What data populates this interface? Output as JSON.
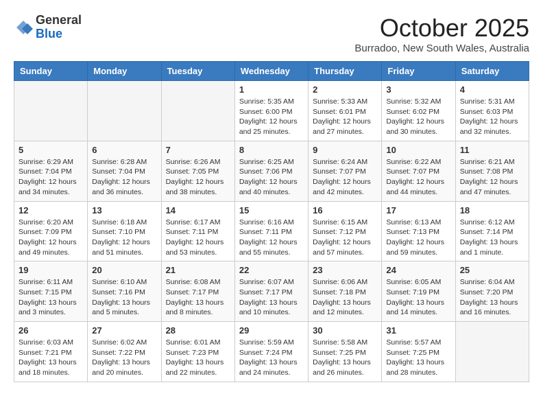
{
  "logo": {
    "general": "General",
    "blue": "Blue"
  },
  "title": {
    "month": "October 2025",
    "location": "Burradoo, New South Wales, Australia"
  },
  "weekdays": [
    "Sunday",
    "Monday",
    "Tuesday",
    "Wednesday",
    "Thursday",
    "Friday",
    "Saturday"
  ],
  "weeks": [
    [
      {
        "day": "",
        "empty": true
      },
      {
        "day": "",
        "empty": true
      },
      {
        "day": "",
        "empty": true
      },
      {
        "day": "1",
        "info": "Sunrise: 5:35 AM\nSunset: 6:00 PM\nDaylight: 12 hours\nand 25 minutes."
      },
      {
        "day": "2",
        "info": "Sunrise: 5:33 AM\nSunset: 6:01 PM\nDaylight: 12 hours\nand 27 minutes."
      },
      {
        "day": "3",
        "info": "Sunrise: 5:32 AM\nSunset: 6:02 PM\nDaylight: 12 hours\nand 30 minutes."
      },
      {
        "day": "4",
        "info": "Sunrise: 5:31 AM\nSunset: 6:03 PM\nDaylight: 12 hours\nand 32 minutes."
      }
    ],
    [
      {
        "day": "5",
        "info": "Sunrise: 6:29 AM\nSunset: 7:04 PM\nDaylight: 12 hours\nand 34 minutes."
      },
      {
        "day": "6",
        "info": "Sunrise: 6:28 AM\nSunset: 7:04 PM\nDaylight: 12 hours\nand 36 minutes."
      },
      {
        "day": "7",
        "info": "Sunrise: 6:26 AM\nSunset: 7:05 PM\nDaylight: 12 hours\nand 38 minutes."
      },
      {
        "day": "8",
        "info": "Sunrise: 6:25 AM\nSunset: 7:06 PM\nDaylight: 12 hours\nand 40 minutes."
      },
      {
        "day": "9",
        "info": "Sunrise: 6:24 AM\nSunset: 7:07 PM\nDaylight: 12 hours\nand 42 minutes."
      },
      {
        "day": "10",
        "info": "Sunrise: 6:22 AM\nSunset: 7:07 PM\nDaylight: 12 hours\nand 44 minutes."
      },
      {
        "day": "11",
        "info": "Sunrise: 6:21 AM\nSunset: 7:08 PM\nDaylight: 12 hours\nand 47 minutes."
      }
    ],
    [
      {
        "day": "12",
        "info": "Sunrise: 6:20 AM\nSunset: 7:09 PM\nDaylight: 12 hours\nand 49 minutes."
      },
      {
        "day": "13",
        "info": "Sunrise: 6:18 AM\nSunset: 7:10 PM\nDaylight: 12 hours\nand 51 minutes."
      },
      {
        "day": "14",
        "info": "Sunrise: 6:17 AM\nSunset: 7:11 PM\nDaylight: 12 hours\nand 53 minutes."
      },
      {
        "day": "15",
        "info": "Sunrise: 6:16 AM\nSunset: 7:11 PM\nDaylight: 12 hours\nand 55 minutes."
      },
      {
        "day": "16",
        "info": "Sunrise: 6:15 AM\nSunset: 7:12 PM\nDaylight: 12 hours\nand 57 minutes."
      },
      {
        "day": "17",
        "info": "Sunrise: 6:13 AM\nSunset: 7:13 PM\nDaylight: 12 hours\nand 59 minutes."
      },
      {
        "day": "18",
        "info": "Sunrise: 6:12 AM\nSunset: 7:14 PM\nDaylight: 13 hours\nand 1 minute."
      }
    ],
    [
      {
        "day": "19",
        "info": "Sunrise: 6:11 AM\nSunset: 7:15 PM\nDaylight: 13 hours\nand 3 minutes."
      },
      {
        "day": "20",
        "info": "Sunrise: 6:10 AM\nSunset: 7:16 PM\nDaylight: 13 hours\nand 5 minutes."
      },
      {
        "day": "21",
        "info": "Sunrise: 6:08 AM\nSunset: 7:17 PM\nDaylight: 13 hours\nand 8 minutes."
      },
      {
        "day": "22",
        "info": "Sunrise: 6:07 AM\nSunset: 7:17 PM\nDaylight: 13 hours\nand 10 minutes."
      },
      {
        "day": "23",
        "info": "Sunrise: 6:06 AM\nSunset: 7:18 PM\nDaylight: 13 hours\nand 12 minutes."
      },
      {
        "day": "24",
        "info": "Sunrise: 6:05 AM\nSunset: 7:19 PM\nDaylight: 13 hours\nand 14 minutes."
      },
      {
        "day": "25",
        "info": "Sunrise: 6:04 AM\nSunset: 7:20 PM\nDaylight: 13 hours\nand 16 minutes."
      }
    ],
    [
      {
        "day": "26",
        "info": "Sunrise: 6:03 AM\nSunset: 7:21 PM\nDaylight: 13 hours\nand 18 minutes."
      },
      {
        "day": "27",
        "info": "Sunrise: 6:02 AM\nSunset: 7:22 PM\nDaylight: 13 hours\nand 20 minutes."
      },
      {
        "day": "28",
        "info": "Sunrise: 6:01 AM\nSunset: 7:23 PM\nDaylight: 13 hours\nand 22 minutes."
      },
      {
        "day": "29",
        "info": "Sunrise: 5:59 AM\nSunset: 7:24 PM\nDaylight: 13 hours\nand 24 minutes."
      },
      {
        "day": "30",
        "info": "Sunrise: 5:58 AM\nSunset: 7:25 PM\nDaylight: 13 hours\nand 26 minutes."
      },
      {
        "day": "31",
        "info": "Sunrise: 5:57 AM\nSunset: 7:25 PM\nDaylight: 13 hours\nand 28 minutes."
      },
      {
        "day": "",
        "empty": true
      }
    ]
  ]
}
